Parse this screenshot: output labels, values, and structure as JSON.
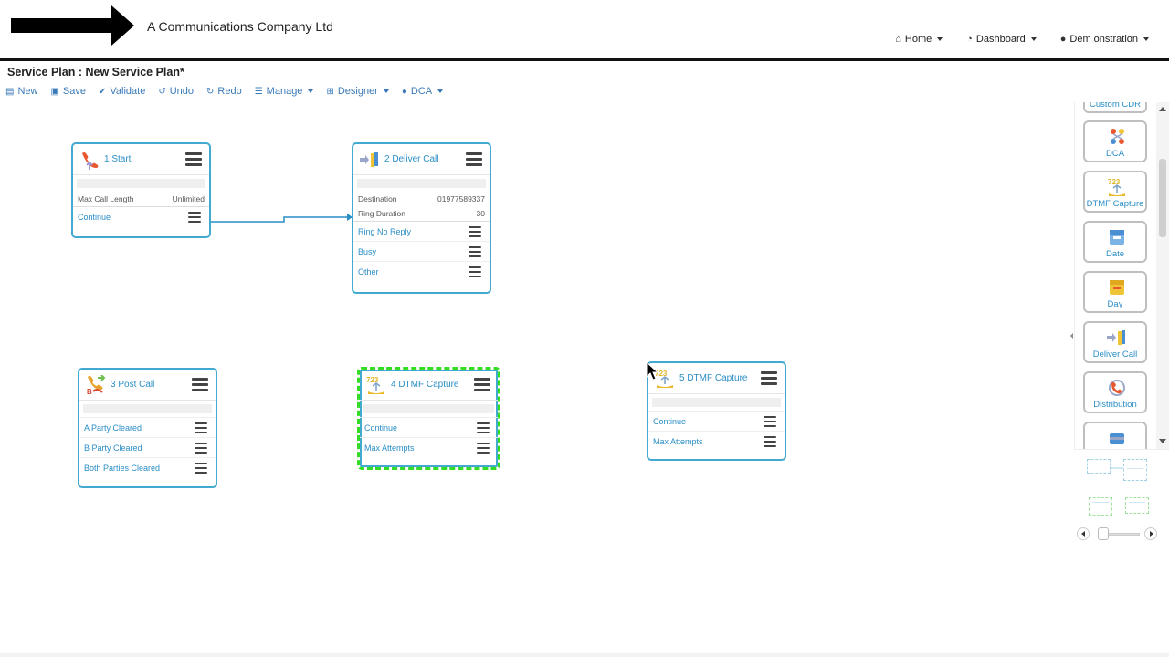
{
  "header": {
    "company": "A Communications Company Ltd",
    "nav": [
      {
        "label": "Home",
        "icon": "home-icon"
      },
      {
        "label": "Dashboard",
        "icon": "dashboard-icon"
      },
      {
        "label": "Dem onstration",
        "icon": "user-icon"
      }
    ]
  },
  "page_title": "Service Plan : New Service Plan*",
  "toolbar": {
    "new": "New",
    "save": "Save",
    "validate": "Validate",
    "undo": "Undo",
    "redo": "Redo",
    "manage": "Manage",
    "designer": "Designer",
    "dca": "DCA"
  },
  "nodes": {
    "start": {
      "title": "1 Start",
      "props": [
        {
          "label": "Max Call Length",
          "value": "Unlimited"
        }
      ],
      "exits": [
        "Continue"
      ]
    },
    "deliver": {
      "title": "2 Deliver Call",
      "props": [
        {
          "label": "Destination",
          "value": "01977589337"
        },
        {
          "label": "Ring Duration",
          "value": "30"
        }
      ],
      "exits": [
        "Ring No Reply",
        "Busy",
        "Other"
      ]
    },
    "postcall": {
      "title": "3 Post Call",
      "exits": [
        "A Party Cleared",
        "B Party Cleared",
        "Both Parties Cleared"
      ]
    },
    "dtmf4": {
      "title": "4 DTMF Capture",
      "exits": [
        "Continue",
        "Max Attempts"
      ]
    },
    "dtmf5": {
      "title": "5 DTMF Capture",
      "exits": [
        "Continue",
        "Max Attempts"
      ]
    }
  },
  "palette": {
    "items": [
      "Custom CDR",
      "DCA",
      "DTMF Capture",
      "Date",
      "Day",
      "Deliver Call",
      "Distribution",
      ""
    ]
  },
  "colors": {
    "node_border": "#42a9d1",
    "selected_border": "#33dd22",
    "link": "#2a8ec6"
  }
}
